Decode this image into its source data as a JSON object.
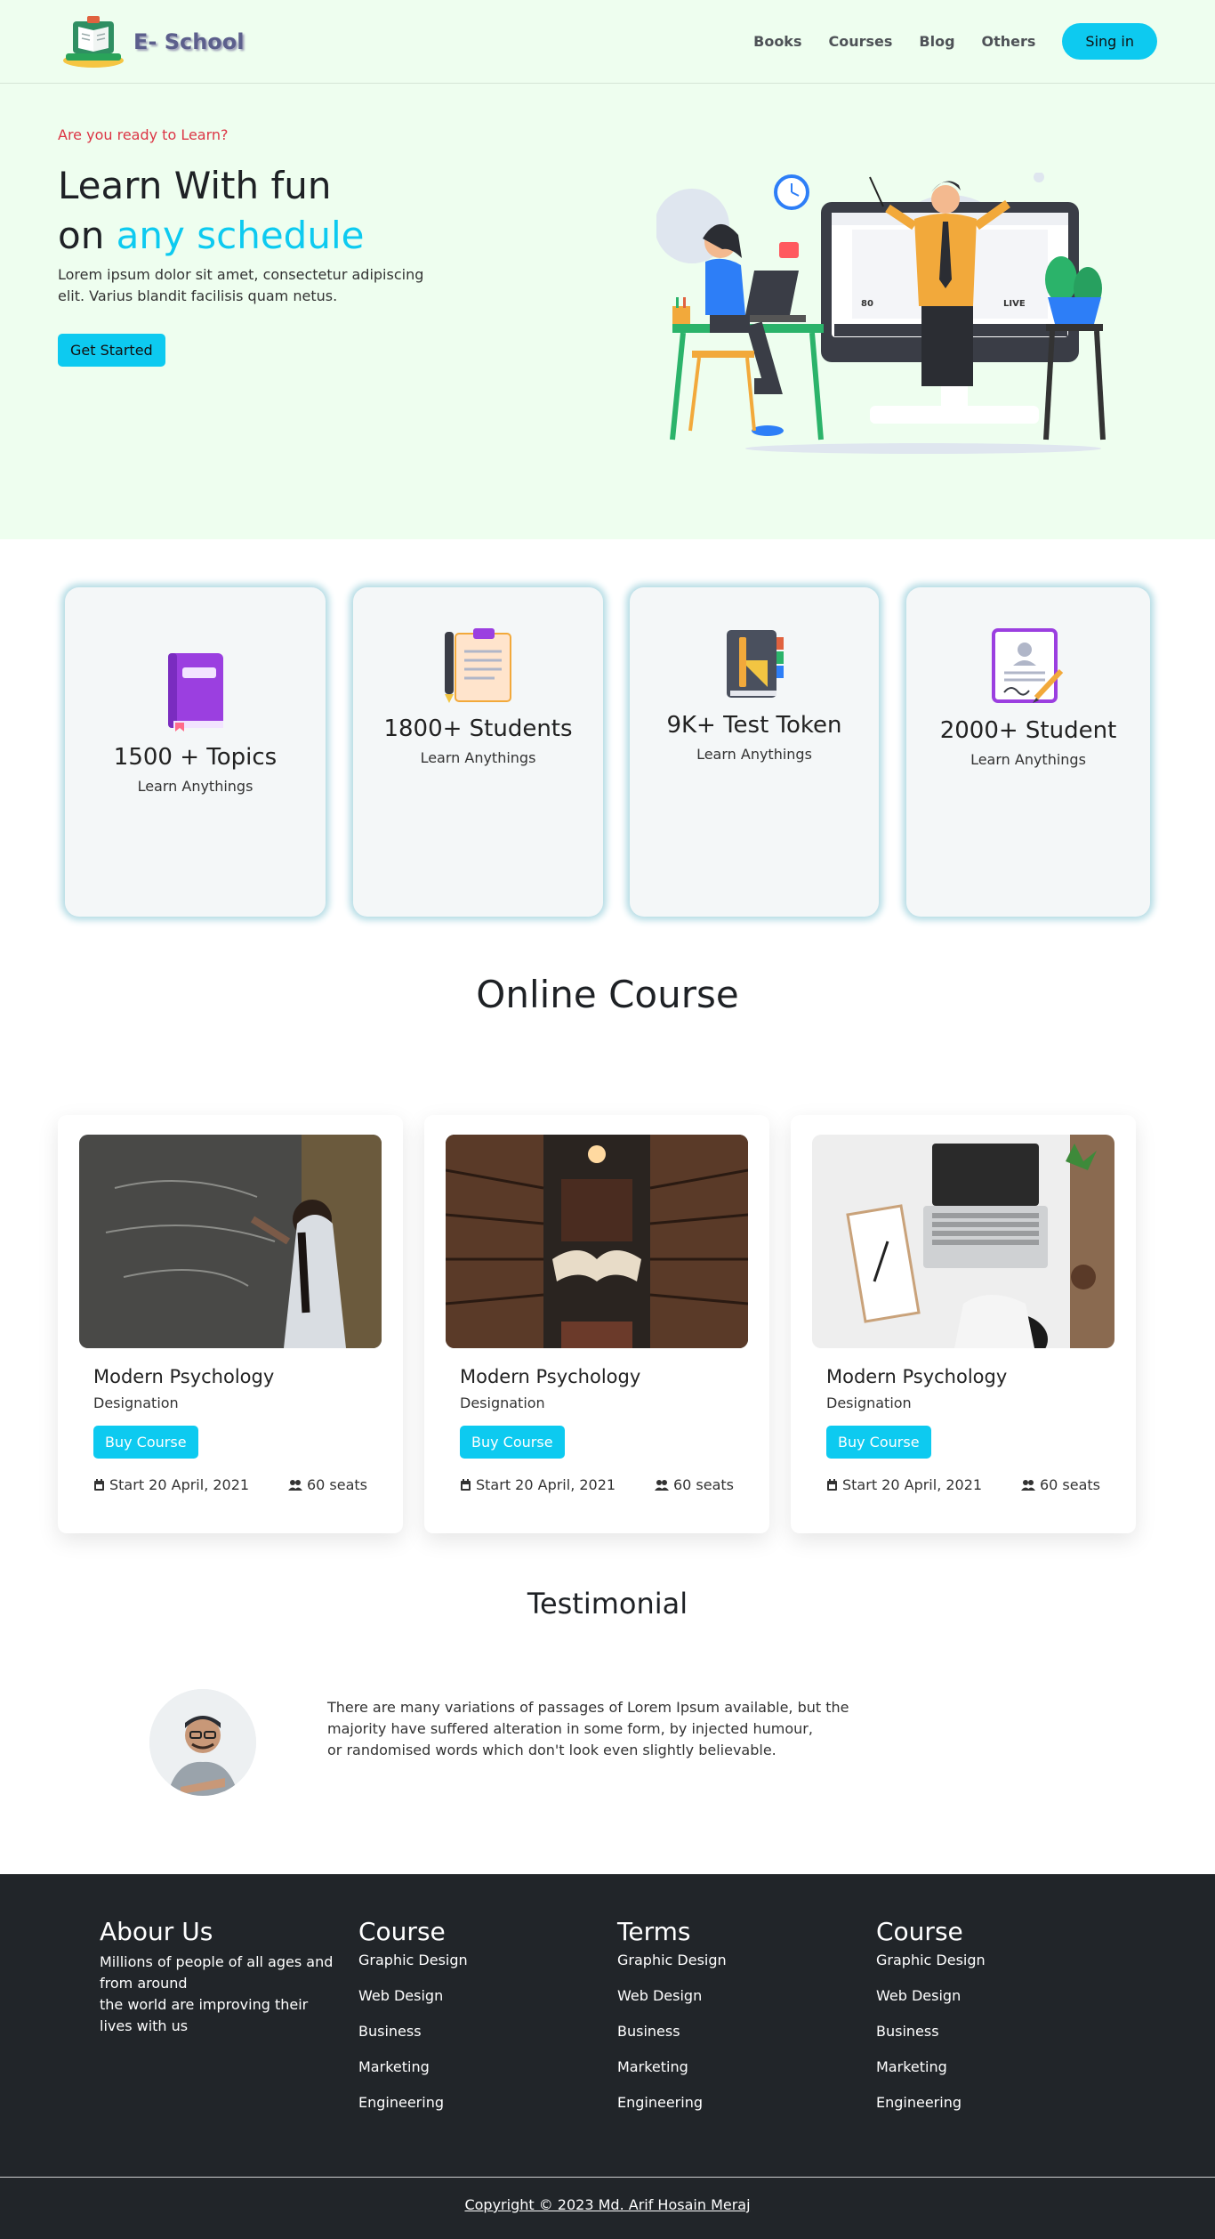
{
  "nav": {
    "brand": "E- School",
    "links": [
      "Books",
      "Courses",
      "Blog",
      "Others"
    ],
    "signin": "Sing in"
  },
  "hero": {
    "kicker": "Are you ready to Learn?",
    "title_line1": "Learn With fun",
    "title_line2_prefix": "on ",
    "title_line2_accent": "any schedule",
    "description": "Lorem ipsum dolor sit amet, consectetur adipiscing elit. Varius blandit facilisis quam netus.",
    "cta": "Get Started",
    "screen_viewers": "80",
    "screen_live": "LIVE"
  },
  "stats": [
    {
      "title": "1500 + Topics",
      "subtitle": "Learn Anythings",
      "icon": "book-icon"
    },
    {
      "title": "1800+ Students",
      "subtitle": "Learn Anythings",
      "icon": "clipboard-icon"
    },
    {
      "title": "9K+ Test Token",
      "subtitle": "Learn Anythings",
      "icon": "notebook-icon"
    },
    {
      "title": "2000+ Student",
      "subtitle": "Learn Anythings",
      "icon": "certificate-icon"
    }
  ],
  "courses_section": {
    "title": "Online Course",
    "courses": [
      {
        "name": "Modern Psychology",
        "designation": "Designation",
        "button": "Buy Course",
        "start": "Start 20 April, 2021",
        "seats": "60 seats"
      },
      {
        "name": "Modern Psychology",
        "designation": "Designation",
        "button": "Buy Course",
        "start": "Start 20 April, 2021",
        "seats": "60 seats"
      },
      {
        "name": "Modern Psychology",
        "designation": "Designation",
        "button": "Buy Course",
        "start": "Start 20 April, 2021",
        "seats": "60 seats"
      }
    ]
  },
  "testimonial": {
    "title": "Testimonial",
    "line1": "There are many variations of passages of Lorem Ipsum available, but the",
    "line2": "majority have suffered alteration in some form, by injected humour,",
    "line3": "or randomised words which don't look even slightly believable."
  },
  "footer": {
    "about": {
      "title": "Abour Us",
      "line1": "Millions of people of all ages and from around",
      "line2": "the world are improving their lives with us"
    },
    "columns": [
      {
        "title": "Course",
        "items": [
          "Graphic Design",
          "Web Design",
          "Business",
          "Marketing",
          "Engineering"
        ]
      },
      {
        "title": "Terms",
        "items": [
          "Graphic Design",
          "Web Design",
          "Business",
          "Marketing",
          "Engineering"
        ]
      },
      {
        "title": "Course",
        "items": [
          "Graphic Design",
          "Web Design",
          "Business",
          "Marketing",
          "Engineering"
        ]
      }
    ],
    "copyright": "Copyright © 2023 Md. Arif Hosain Meraj"
  },
  "colors": {
    "accent": "#0dcaf0",
    "hero_bg": "#eefeef",
    "kicker": "#dc3545",
    "footer_bg": "#212529"
  }
}
